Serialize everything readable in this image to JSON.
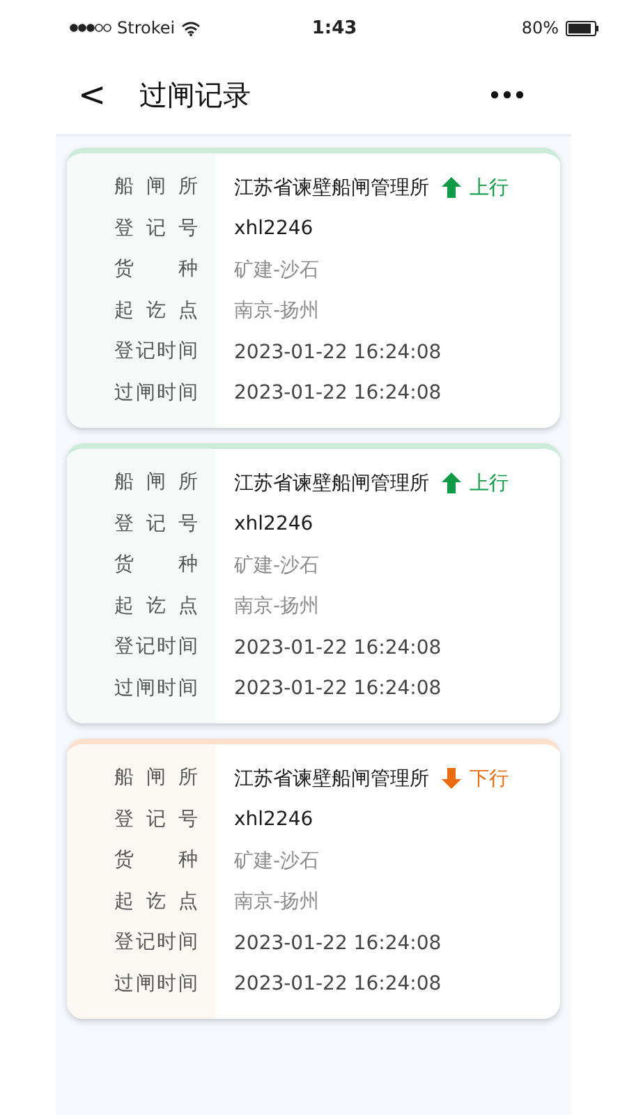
{
  "status_bar": {
    "carrier": "Strokei",
    "time": "1:43",
    "battery": "80%"
  },
  "header": {
    "back": "<",
    "title": "过闸记录"
  },
  "records": [
    {
      "kind": "up",
      "direction_label": "上行",
      "rows": [
        {
          "label": "船 闸 所",
          "value": "江苏省谏壁船闸管理所",
          "kind": "primary"
        },
        {
          "label": "登 记 号",
          "value": "xhl2246",
          "kind": "primary"
        },
        {
          "label": "货 种",
          "value": "矿建-沙石",
          "kind": "muted"
        },
        {
          "label": "起 讫 点",
          "value": "南京-扬州",
          "kind": "muted"
        },
        {
          "label": "登记时间",
          "value": "2023-01-22 16:24:08",
          "kind": "normal"
        },
        {
          "label": "过闸时间",
          "value": "2023-01-22 16:24:08",
          "kind": "normal"
        }
      ]
    },
    {
      "kind": "up",
      "direction_label": "上行",
      "rows": [
        {
          "label": "船 闸 所",
          "value": "江苏省谏壁船闸管理所",
          "kind": "primary"
        },
        {
          "label": "登 记 号",
          "value": "xhl2246",
          "kind": "primary"
        },
        {
          "label": "货 种",
          "value": "矿建-沙石",
          "kind": "muted"
        },
        {
          "label": "起 讫 点",
          "value": "南京-扬州",
          "kind": "muted"
        },
        {
          "label": "登记时间",
          "value": "2023-01-22 16:24:08",
          "kind": "normal"
        },
        {
          "label": "过闸时间",
          "value": "2023-01-22 16:24:08",
          "kind": "normal"
        }
      ]
    },
    {
      "kind": "down",
      "direction_label": "下行",
      "rows": [
        {
          "label": "船 闸 所",
          "value": "江苏省谏壁船闸管理所",
          "kind": "primary"
        },
        {
          "label": "登 记 号",
          "value": "xhl2246",
          "kind": "primary"
        },
        {
          "label": "货 种",
          "value": "矿建-沙石",
          "kind": "muted"
        },
        {
          "label": "起 讫 点",
          "value": "南京-扬州",
          "kind": "muted"
        },
        {
          "label": "登记时间",
          "value": "2023-01-22 16:24:08",
          "kind": "normal"
        },
        {
          "label": "过闸时间",
          "value": "2023-01-22 16:24:08",
          "kind": "normal"
        }
      ]
    }
  ]
}
